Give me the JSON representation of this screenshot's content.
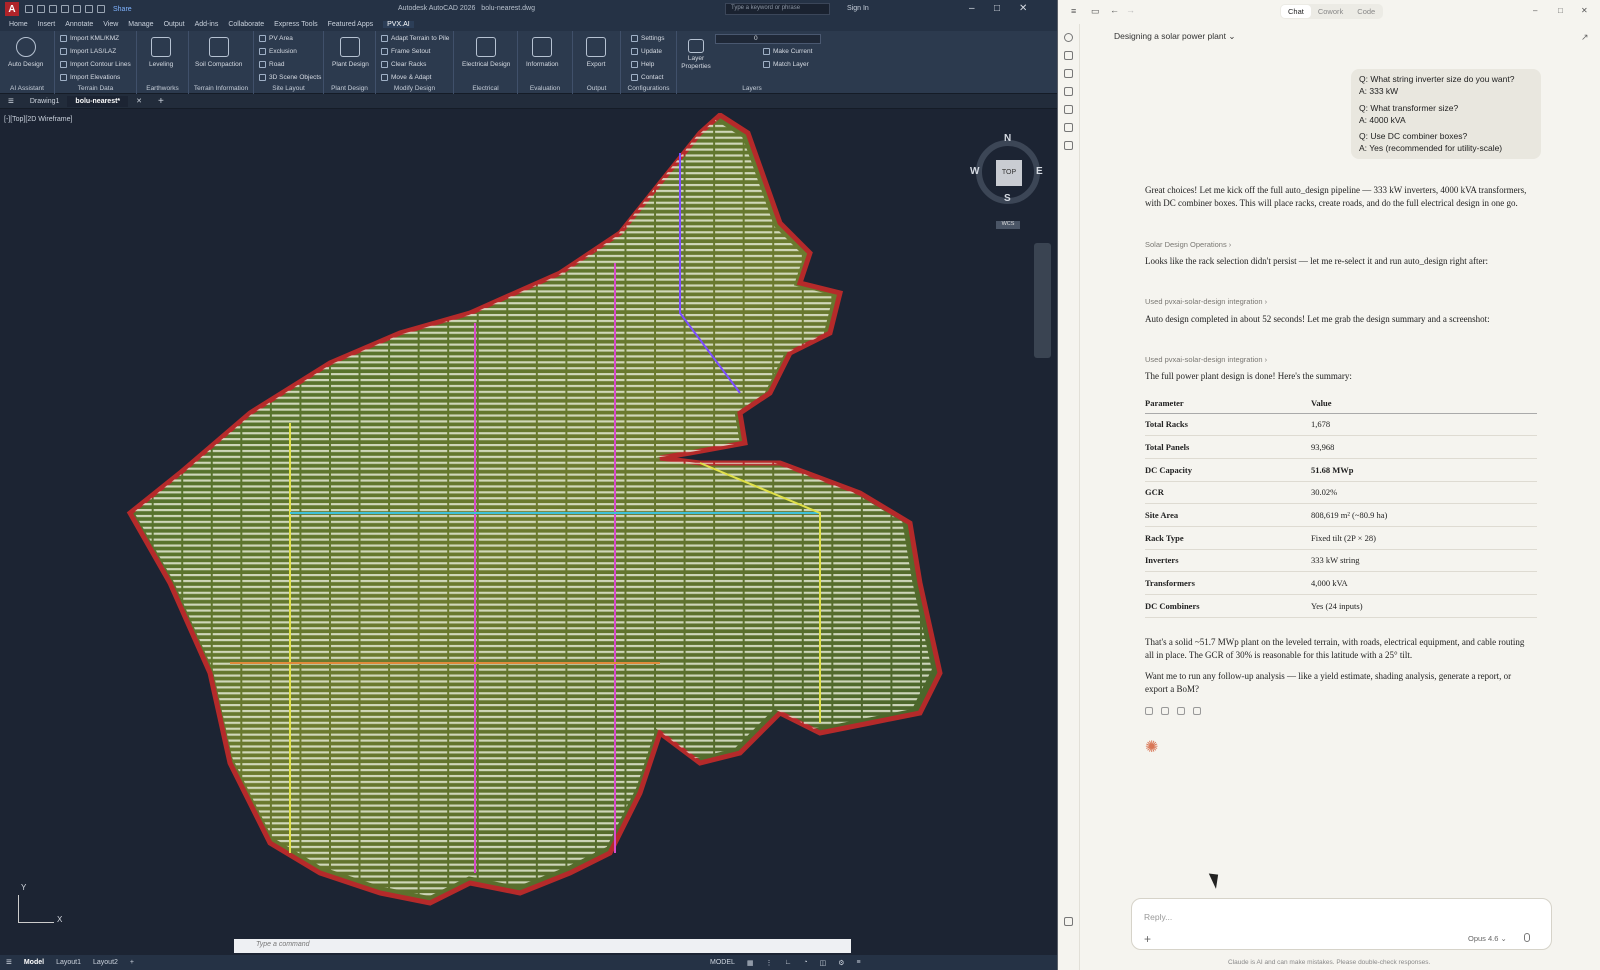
{
  "autocad": {
    "app_title": "Autodesk AutoCAD 2026",
    "file": "bolu-nearest.dwg",
    "share": "Share",
    "search_placeholder": "Type a keyword or phrase",
    "sign_in": "Sign In",
    "menus": [
      "Home",
      "Insert",
      "Annotate",
      "View",
      "Manage",
      "Output",
      "Add-ins",
      "Collaborate",
      "Express Tools",
      "Featured Apps",
      "PVX.AI"
    ],
    "active_menu": "PVX.AI",
    "ribbon": {
      "auto_design": "Auto Design",
      "ai_assistant": "AI Assistant",
      "terrain_items": [
        "Import KML/KMZ",
        "Import LAS/LAZ",
        "Import Contour Lines",
        "Import Elevations"
      ],
      "terrain_data": "Terrain Data",
      "leveling": "Leveling",
      "earthworks": "Earthworks",
      "soil": "Soil Compaction",
      "terrain_info": "Terrain Information",
      "site_items": [
        "PV Area",
        "Exclusion",
        "Road",
        "3D Scene Objects"
      ],
      "site_layout": "Site Layout",
      "plant_design_btn": "Plant Design",
      "plant_design": "Plant Design",
      "modify_items": [
        "Adapt Terrain to Pile",
        "Frame Setout",
        "Clear Racks",
        "Move & Adapt"
      ],
      "modify_design": "Modify Design",
      "electrical_btn": "Electrical Design",
      "electrical": "Electrical",
      "information": "Information",
      "evaluation": "Evaluation",
      "export": "Export",
      "output": "Output",
      "config_items": [
        "Settings",
        "Update",
        "Help",
        "Contact"
      ],
      "configurations": "Configurations",
      "layer_properties": "Layer Properties",
      "make_current": "Make Current",
      "match_layer": "Match Layer",
      "layers": "Layers",
      "layer_value": "0"
    },
    "doc_tabs": [
      "Drawing1",
      "bolu-nearest*"
    ],
    "viewport_label": "[-][Top][2D Wireframe]",
    "compass": {
      "n": "N",
      "s": "S",
      "e": "E",
      "w": "W",
      "top": "TOP",
      "wcs": "WCS"
    },
    "ucs": {
      "x": "X",
      "y": "Y"
    },
    "command_placeholder": "Type a command",
    "layouts": [
      "Model",
      "Layout1",
      "Layout2"
    ],
    "status_model": "MODEL"
  },
  "claude": {
    "tabs": [
      "Chat",
      "Cowork",
      "Code"
    ],
    "active_tab": "Chat",
    "conversation_title": "Designing a solar power plant",
    "qa": [
      {
        "q": "Q: What string inverter size do you want?",
        "a": "A: 333 kW"
      },
      {
        "q": "Q: What transformer size?",
        "a": "A: 4000 kVA"
      },
      {
        "q": "Q: Use DC combiner boxes?",
        "a": "A: Yes (recommended for utility-scale)"
      }
    ],
    "msg1": "Great choices! Let me kick off the full auto_design pipeline — 333 kW inverters, 4000 kVA transformers, with DC combiner boxes. This will place racks, create roads, and do the full electrical design in one go.",
    "tool1": "Solar Design Operations ›",
    "msg2": "Looks like the rack selection didn't persist — let me re-select it and run auto_design right after:",
    "tool2": "Used pvxai-solar-design integration ›",
    "msg3": "Auto design completed in about 52 seconds! Let me grab the design summary and a screenshot:",
    "tool3": "Used pvxai-solar-design integration ›",
    "msg4": "The full power plant design is done! Here's the summary:",
    "table_headers": [
      "Parameter",
      "Value"
    ],
    "table_rows": [
      [
        "Total Racks",
        "1,678"
      ],
      [
        "Total Panels",
        "93,968"
      ],
      [
        "DC Capacity",
        "51.68 MWp"
      ],
      [
        "GCR",
        "30.02%"
      ],
      [
        "Site Area",
        "808,619 m² (~80.9 ha)"
      ],
      [
        "Rack Type",
        "Fixed tilt (2P × 28)"
      ],
      [
        "Inverters",
        "333 kW string"
      ],
      [
        "Transformers",
        "4,000 kVA"
      ],
      [
        "DC Combiners",
        "Yes (24 inputs)"
      ]
    ],
    "msg5": "That's a solid ~51.7 MWp plant on the leveled terrain, with roads, electrical equipment, and cable routing all in place. The GCR of 30% is reasonable for this latitude with a 25° tilt.",
    "msg6": "Want me to run any follow-up analysis — like a yield estimate, shading analysis, generate a report, or export a BoM?",
    "reply_placeholder": "Reply...",
    "model": "Opus 4.6",
    "disclaimer": "Claude is AI and can make mistakes. Please double-check responses."
  }
}
